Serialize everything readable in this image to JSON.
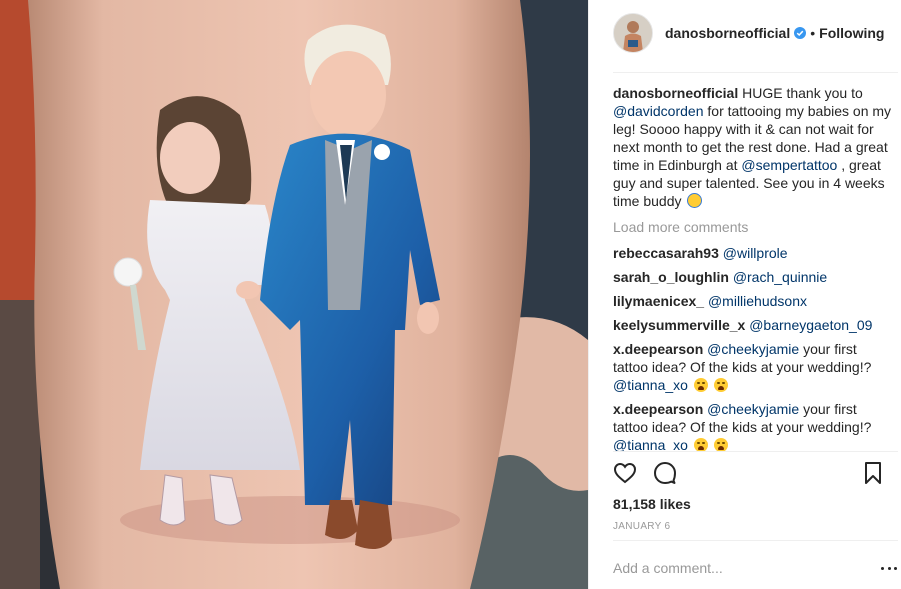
{
  "post": {
    "username": "danosborneofficial",
    "separator": "•",
    "follow_status": "Following",
    "caption": {
      "text_1": "HUGE thank you to ",
      "mention_1": "@davidcorden",
      "text_2": " for tattooing my babies on my leg! Soooo happy with it & can not wait for next month to get the rest done. Had a great time in Edinburgh at ",
      "mention_2": "@sempertattoo",
      "text_3": " , great guy and super talented. See you in 4 weeks time buddy ",
      "emoji": "raising-hands-emoji"
    },
    "load_more": "Load more comments",
    "comments": [
      {
        "user": "rebeccasarah93",
        "mention": "@willprole",
        "text": ""
      },
      {
        "user": "sarah_o_loughlin",
        "mention": "@rach_quinnie",
        "text": ""
      },
      {
        "user": "lilymaenicex_",
        "mention": "@milliehudsonx",
        "text": ""
      },
      {
        "user": "keelysummerville_x",
        "mention": "@barneygaeton_09",
        "text": ""
      },
      {
        "user": "x.deepearson",
        "mention": "@cheekyjamie",
        "text": " your first tattoo idea? Of the kids at your wedding!? ",
        "mention_2": "@tianna_xo",
        "emoji": "weary-face-emoji"
      },
      {
        "user": "x.deepearson",
        "mention": "@cheekyjamie",
        "text": " your first tattoo idea? Of the kids at your wedding!? ",
        "mention_2": "@tianna_xo",
        "emoji": "weary-face-emoji"
      }
    ],
    "likes": "81,158 likes",
    "date": "JANUARY 6",
    "comment_placeholder": "Add a comment...",
    "icons": {
      "like": "heart-icon",
      "comment": "comment-bubble-icon",
      "save": "bookmark-icon",
      "options": "more-options-icon",
      "verified": "verified-badge-icon"
    },
    "colors": {
      "text": "#262626",
      "mention": "#003569",
      "muted": "#999999",
      "verified": "#3897f0",
      "divider": "#efefef"
    }
  }
}
